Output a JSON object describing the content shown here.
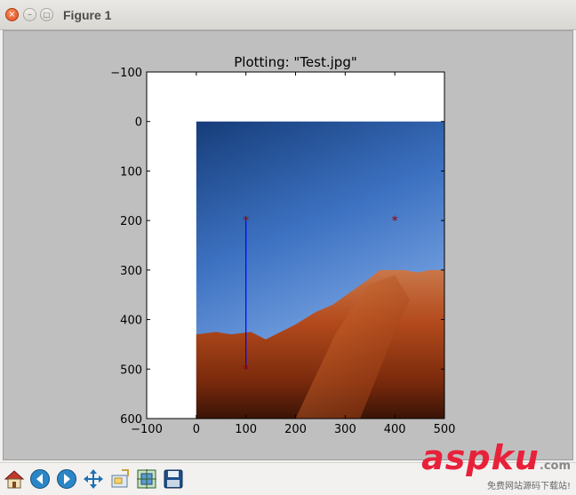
{
  "window": {
    "title": "Figure 1"
  },
  "colors": {
    "line": "#0000ff",
    "marker": "#8b0000",
    "figure_bg": "#bfbfbf"
  },
  "toolbar": {
    "buttons": [
      {
        "name": "home-button",
        "icon": "house-icon"
      },
      {
        "name": "back-button",
        "icon": "arrow-left-icon"
      },
      {
        "name": "forward-button",
        "icon": "arrow-right-icon"
      },
      {
        "name": "pan-button",
        "icon": "move-arrows-icon"
      },
      {
        "name": "zoom-button",
        "icon": "zoom-rect-icon"
      },
      {
        "name": "subplots-button",
        "icon": "subplots-icon"
      },
      {
        "name": "save-button",
        "icon": "floppy-disk-icon"
      }
    ]
  },
  "watermark": {
    "main": "aspku",
    "suffix": ".com",
    "sub": "免费网站源码下载站!"
  },
  "chart_data": {
    "type": "line",
    "title": "Plotting: \"Test.jpg\"",
    "xlim": [
      -100,
      500
    ],
    "ylim": [
      600,
      -100
    ],
    "x_ticks": [
      -100,
      0,
      100,
      200,
      300,
      400,
      500
    ],
    "y_ticks": [
      -100,
      0,
      100,
      200,
      300,
      400,
      500,
      600
    ],
    "image_extent": {
      "x": [
        0,
        500
      ],
      "y": [
        0,
        600
      ]
    },
    "series": [
      {
        "style": "line",
        "x": [
          100,
          100
        ],
        "y": [
          200,
          500
        ]
      },
      {
        "style": "star-markers",
        "x": [
          100,
          400,
          100
        ],
        "y": [
          200,
          200,
          500
        ]
      }
    ],
    "grid": false
  }
}
